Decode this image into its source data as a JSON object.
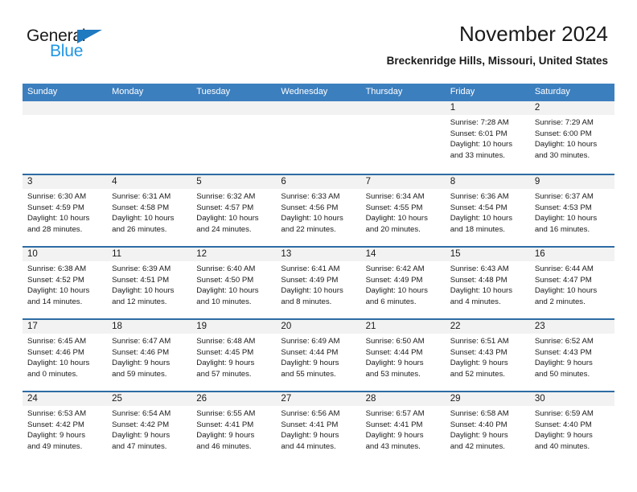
{
  "brand": {
    "name_part1": "General",
    "name_part2": "Blue",
    "triangle_color": "#1f7ac0",
    "blue_color": "#2196e3"
  },
  "header": {
    "title": "November 2024",
    "location": "Breckenridge Hills, Missouri, United States"
  },
  "colors": {
    "weekday_header_bg": "#3c7fbf",
    "weekday_header_text": "#ffffff",
    "row_border": "#2e6ca4",
    "date_strip_bg": "#f2f2f2",
    "body_text": "#1a1a1a"
  },
  "weekdays": [
    "Sunday",
    "Monday",
    "Tuesday",
    "Wednesday",
    "Thursday",
    "Friday",
    "Saturday"
  ],
  "weeks": [
    [
      {
        "day": "",
        "info": ""
      },
      {
        "day": "",
        "info": ""
      },
      {
        "day": "",
        "info": ""
      },
      {
        "day": "",
        "info": ""
      },
      {
        "day": "",
        "info": ""
      },
      {
        "day": "1",
        "info": "Sunrise: 7:28 AM\nSunset: 6:01 PM\nDaylight: 10 hours\nand 33 minutes."
      },
      {
        "day": "2",
        "info": "Sunrise: 7:29 AM\nSunset: 6:00 PM\nDaylight: 10 hours\nand 30 minutes."
      }
    ],
    [
      {
        "day": "3",
        "info": "Sunrise: 6:30 AM\nSunset: 4:59 PM\nDaylight: 10 hours\nand 28 minutes."
      },
      {
        "day": "4",
        "info": "Sunrise: 6:31 AM\nSunset: 4:58 PM\nDaylight: 10 hours\nand 26 minutes."
      },
      {
        "day": "5",
        "info": "Sunrise: 6:32 AM\nSunset: 4:57 PM\nDaylight: 10 hours\nand 24 minutes."
      },
      {
        "day": "6",
        "info": "Sunrise: 6:33 AM\nSunset: 4:56 PM\nDaylight: 10 hours\nand 22 minutes."
      },
      {
        "day": "7",
        "info": "Sunrise: 6:34 AM\nSunset: 4:55 PM\nDaylight: 10 hours\nand 20 minutes."
      },
      {
        "day": "8",
        "info": "Sunrise: 6:36 AM\nSunset: 4:54 PM\nDaylight: 10 hours\nand 18 minutes."
      },
      {
        "day": "9",
        "info": "Sunrise: 6:37 AM\nSunset: 4:53 PM\nDaylight: 10 hours\nand 16 minutes."
      }
    ],
    [
      {
        "day": "10",
        "info": "Sunrise: 6:38 AM\nSunset: 4:52 PM\nDaylight: 10 hours\nand 14 minutes."
      },
      {
        "day": "11",
        "info": "Sunrise: 6:39 AM\nSunset: 4:51 PM\nDaylight: 10 hours\nand 12 minutes."
      },
      {
        "day": "12",
        "info": "Sunrise: 6:40 AM\nSunset: 4:50 PM\nDaylight: 10 hours\nand 10 minutes."
      },
      {
        "day": "13",
        "info": "Sunrise: 6:41 AM\nSunset: 4:49 PM\nDaylight: 10 hours\nand 8 minutes."
      },
      {
        "day": "14",
        "info": "Sunrise: 6:42 AM\nSunset: 4:49 PM\nDaylight: 10 hours\nand 6 minutes."
      },
      {
        "day": "15",
        "info": "Sunrise: 6:43 AM\nSunset: 4:48 PM\nDaylight: 10 hours\nand 4 minutes."
      },
      {
        "day": "16",
        "info": "Sunrise: 6:44 AM\nSunset: 4:47 PM\nDaylight: 10 hours\nand 2 minutes."
      }
    ],
    [
      {
        "day": "17",
        "info": "Sunrise: 6:45 AM\nSunset: 4:46 PM\nDaylight: 10 hours\nand 0 minutes."
      },
      {
        "day": "18",
        "info": "Sunrise: 6:47 AM\nSunset: 4:46 PM\nDaylight: 9 hours\nand 59 minutes."
      },
      {
        "day": "19",
        "info": "Sunrise: 6:48 AM\nSunset: 4:45 PM\nDaylight: 9 hours\nand 57 minutes."
      },
      {
        "day": "20",
        "info": "Sunrise: 6:49 AM\nSunset: 4:44 PM\nDaylight: 9 hours\nand 55 minutes."
      },
      {
        "day": "21",
        "info": "Sunrise: 6:50 AM\nSunset: 4:44 PM\nDaylight: 9 hours\nand 53 minutes."
      },
      {
        "day": "22",
        "info": "Sunrise: 6:51 AM\nSunset: 4:43 PM\nDaylight: 9 hours\nand 52 minutes."
      },
      {
        "day": "23",
        "info": "Sunrise: 6:52 AM\nSunset: 4:43 PM\nDaylight: 9 hours\nand 50 minutes."
      }
    ],
    [
      {
        "day": "24",
        "info": "Sunrise: 6:53 AM\nSunset: 4:42 PM\nDaylight: 9 hours\nand 49 minutes."
      },
      {
        "day": "25",
        "info": "Sunrise: 6:54 AM\nSunset: 4:42 PM\nDaylight: 9 hours\nand 47 minutes."
      },
      {
        "day": "26",
        "info": "Sunrise: 6:55 AM\nSunset: 4:41 PM\nDaylight: 9 hours\nand 46 minutes."
      },
      {
        "day": "27",
        "info": "Sunrise: 6:56 AM\nSunset: 4:41 PM\nDaylight: 9 hours\nand 44 minutes."
      },
      {
        "day": "28",
        "info": "Sunrise: 6:57 AM\nSunset: 4:41 PM\nDaylight: 9 hours\nand 43 minutes."
      },
      {
        "day": "29",
        "info": "Sunrise: 6:58 AM\nSunset: 4:40 PM\nDaylight: 9 hours\nand 42 minutes."
      },
      {
        "day": "30",
        "info": "Sunrise: 6:59 AM\nSunset: 4:40 PM\nDaylight: 9 hours\nand 40 minutes."
      }
    ]
  ]
}
